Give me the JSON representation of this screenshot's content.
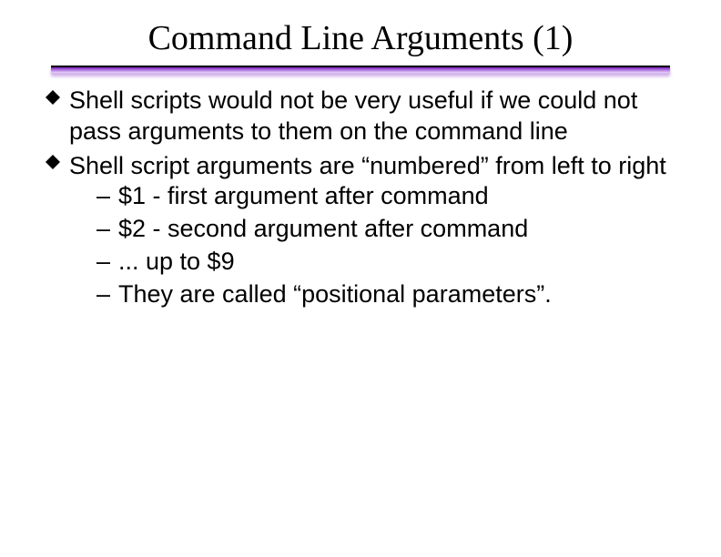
{
  "title": "Command Line Arguments (1)",
  "bullets": [
    {
      "text": "Shell scripts would not be very useful if we could not pass arguments to them on the command line"
    },
    {
      "text": "Shell script arguments are “numbered” from left to right",
      "sub": [
        "$1 - first argument after command",
        "$2 - second argument after command",
        "... up to $9",
        "They are called “positional parameters”."
      ]
    }
  ]
}
